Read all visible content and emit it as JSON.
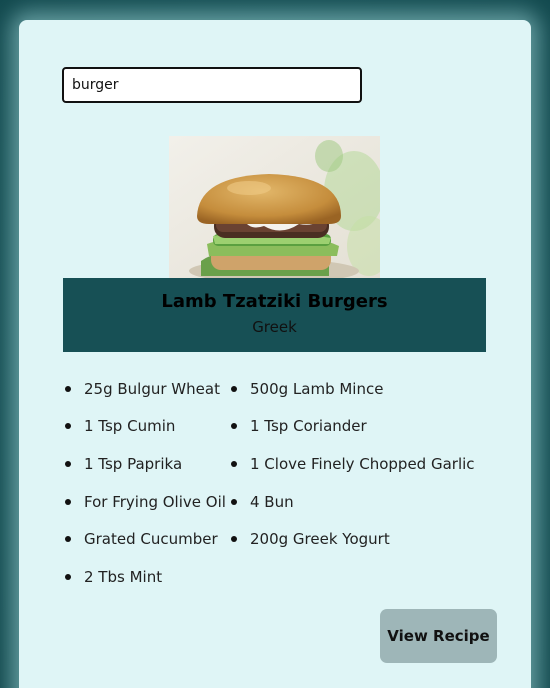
{
  "search": {
    "value": "burger"
  },
  "recipe": {
    "image_alt": "Lamb Tzatziki Burgers",
    "title": "Lamb Tzatziki Burgers",
    "cuisine": "Greek",
    "ingredients": [
      "25g Bulgur Wheat",
      "500g Lamb Mince",
      "1 Tsp Cumin",
      "1 Tsp Coriander",
      "1 Tsp Paprika",
      "1 Clove Finely Chopped Garlic",
      "For Frying Olive Oil",
      "4 Bun",
      "Grated Cucumber",
      "200g Greek Yogurt",
      "2 Tbs Mint"
    ],
    "view_button": "View Recipe"
  },
  "colors": {
    "page_background": "#175055",
    "card_background": "#dff5f6",
    "banner": "#175055",
    "button": "#9eb6b8"
  }
}
